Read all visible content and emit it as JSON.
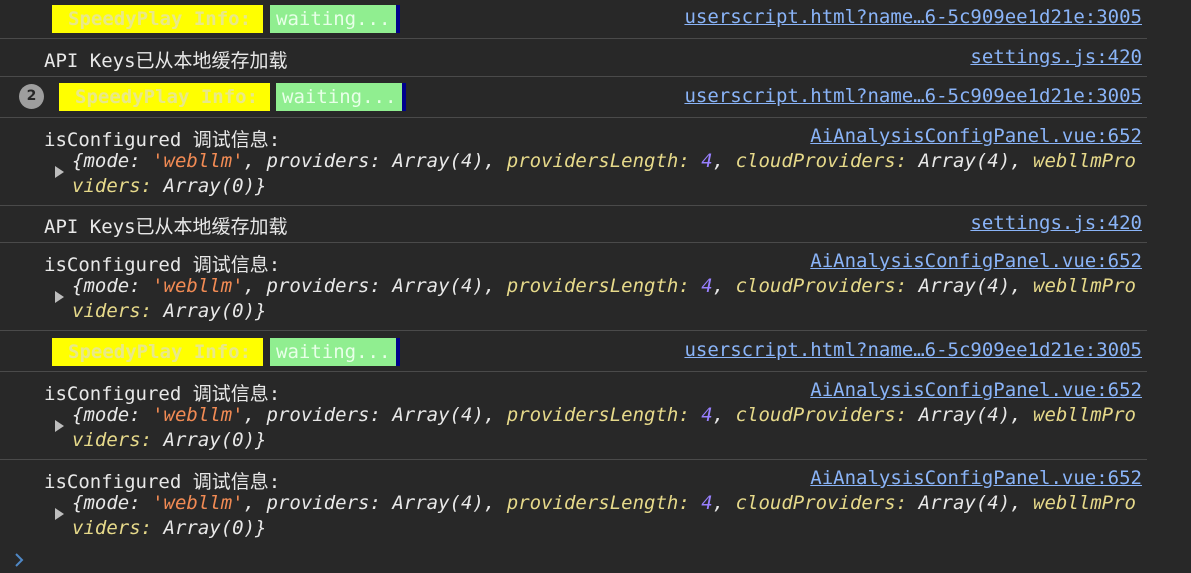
{
  "rows": [
    {
      "type": "speedy",
      "badge_label": "SpeedyPlay Info:",
      "status": "waiting...",
      "source": "userscript.html?name…6-5c909ee1d21e:3005"
    },
    {
      "type": "text",
      "message": "API Keys已从本地缓存加载",
      "source": "settings.js:420"
    },
    {
      "type": "speedy",
      "count": "2",
      "badge_label": "SpeedyPlay Info:",
      "status": "waiting...",
      "source": "userscript.html?name…6-5c909ee1d21e:3005"
    },
    {
      "type": "object",
      "message": "isConfigured 调试信息:",
      "source": "AiAnalysisConfigPanel.vue:652"
    },
    {
      "type": "text",
      "message": "API Keys已从本地缓存加载",
      "source": "settings.js:420"
    },
    {
      "type": "object",
      "message": "isConfigured 调试信息:",
      "source": "AiAnalysisConfigPanel.vue:652"
    },
    {
      "type": "speedy",
      "badge_label": "SpeedyPlay Info:",
      "status": "waiting...",
      "source": "userscript.html?name…6-5c909ee1d21e:3005"
    },
    {
      "type": "object",
      "message": "isConfigured 调试信息:",
      "source": "AiAnalysisConfigPanel.vue:652"
    },
    {
      "type": "object",
      "message": "isConfigured 调试信息:",
      "source": "AiAnalysisConfigPanel.vue:652"
    }
  ],
  "object_preview": {
    "open": "{",
    "k_mode": "mode",
    "v_mode": "'webllm'",
    "k_providers": "providers",
    "v_providers": "Array(4)",
    "k_providers_length": "providersLength",
    "v_providers_length": "4",
    "k_cloud": "cloudProviders",
    "v_cloud": "Array(4)",
    "k_webllm": "webllmProviders",
    "v_webllm": "Array(0)",
    "close": "}"
  },
  "prompt_icon": "chevron-right-icon"
}
